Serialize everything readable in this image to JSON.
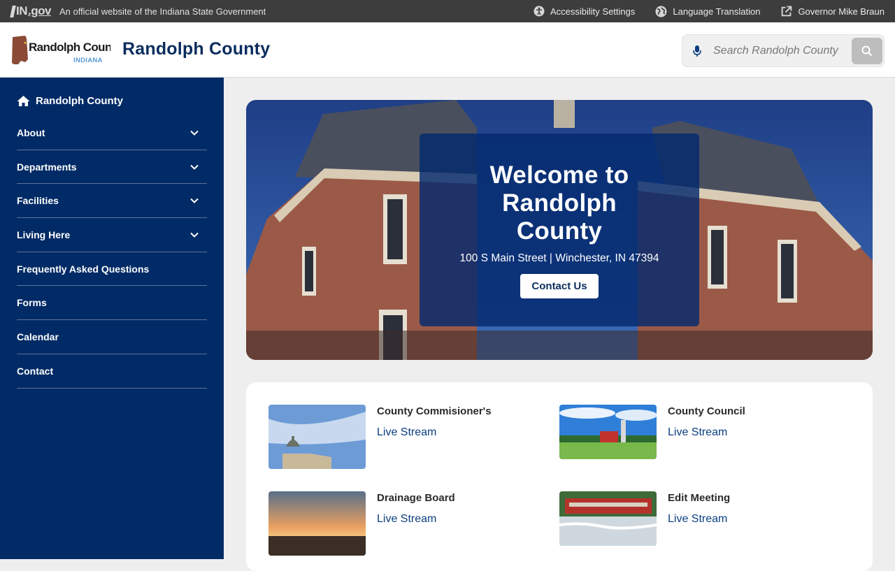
{
  "statebar": {
    "logo_in": "IN",
    "logo_gov": ".gov",
    "official_text": "An official website of the Indiana State Government",
    "links": [
      {
        "label": "Accessibility Settings",
        "icon": "accessibility-icon"
      },
      {
        "label": "Language Translation",
        "icon": "globe-icon"
      },
      {
        "label": "Governor Mike Braun",
        "icon": "external-link-icon"
      }
    ]
  },
  "header": {
    "logo_name": "Randolph County",
    "logo_state": "INDIANA",
    "site_title": "Randolph County",
    "search_placeholder": "Search Randolph County"
  },
  "sidebar": {
    "home_label": "Randolph County",
    "items": [
      {
        "label": "About",
        "expandable": true
      },
      {
        "label": "Departments",
        "expandable": true
      },
      {
        "label": "Facilities",
        "expandable": true
      },
      {
        "label": "Living Here",
        "expandable": true
      },
      {
        "label": "Frequently Asked Questions",
        "expandable": false
      },
      {
        "label": "Forms",
        "expandable": false
      },
      {
        "label": "Calendar",
        "expandable": false
      },
      {
        "label": "Contact",
        "expandable": false
      }
    ]
  },
  "hero": {
    "title": "Welcome to Randolph County",
    "address": "100 S Main Street | Winchester, IN 47394",
    "button_label": "Contact Us"
  },
  "cards": [
    {
      "title": "County Commisioner's",
      "link": "Live Stream"
    },
    {
      "title": "County Council",
      "link": "Live Stream"
    },
    {
      "title": "Drainage Board",
      "link": "Live Stream"
    },
    {
      "title": "Edit Meeting",
      "link": "Live Stream"
    }
  ],
  "colors": {
    "navy": "#012b66",
    "title_blue": "#0b2d5e",
    "statebar": "#3d3d3d"
  }
}
